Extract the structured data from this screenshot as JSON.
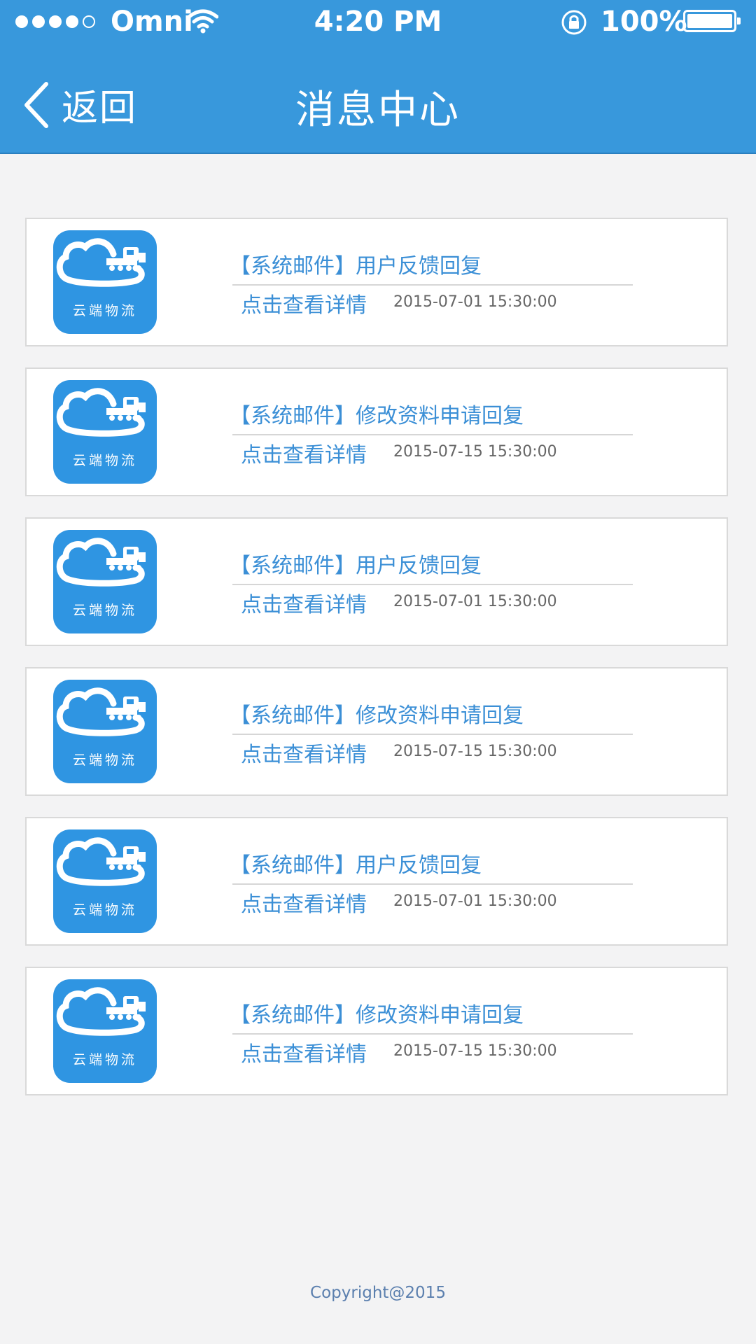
{
  "status_bar": {
    "carrier": "Omni",
    "time": "4:20 PM",
    "battery": "100%"
  },
  "nav": {
    "back_label": "返回",
    "title": "消息中心"
  },
  "logo_text": "云端物流",
  "messages": [
    {
      "title": "【系统邮件】用户反馈回复",
      "link": "点击查看详情",
      "time": "2015-07-01 15:30:00"
    },
    {
      "title": "【系统邮件】修改资料申请回复",
      "link": "点击查看详情",
      "time": "2015-07-15 15:30:00"
    },
    {
      "title": "【系统邮件】用户反馈回复",
      "link": "点击查看详情",
      "time": "2015-07-01 15:30:00"
    },
    {
      "title": "【系统邮件】修改资料申请回复",
      "link": "点击查看详情",
      "time": "2015-07-15 15:30:00"
    },
    {
      "title": "【系统邮件】用户反馈回复",
      "link": "点击查看详情",
      "time": "2015-07-01 15:30:00"
    },
    {
      "title": "【系统邮件】修改资料申请回复",
      "link": "点击查看详情",
      "time": "2015-07-15 15:30:00"
    }
  ],
  "footer": {
    "copyright": "Copyright@2015"
  },
  "colors": {
    "header_bg": "#3898dc",
    "accent": "#3b8fd6",
    "logo_bg": "#2f95e2"
  }
}
